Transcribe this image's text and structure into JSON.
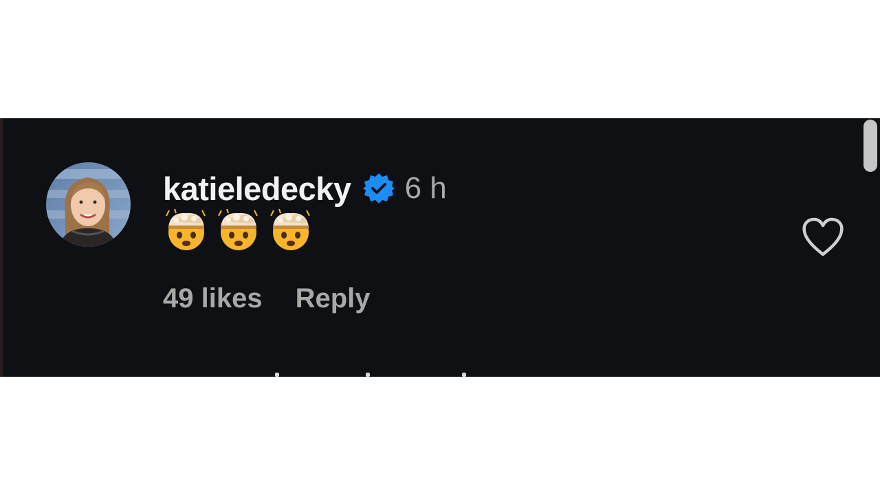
{
  "comment": {
    "username": "katieledecky",
    "verified": true,
    "timestamp": "6 h",
    "emoji_count": 3,
    "emoji_name": "exploding-head",
    "likes": "49 likes",
    "reply_label": "Reply",
    "liked": false
  },
  "colors": {
    "background": "#0e1014",
    "verified_badge": "#1d8cf4",
    "muted_text": "#a8a8a8",
    "primary_text": "#f2f2f2"
  }
}
